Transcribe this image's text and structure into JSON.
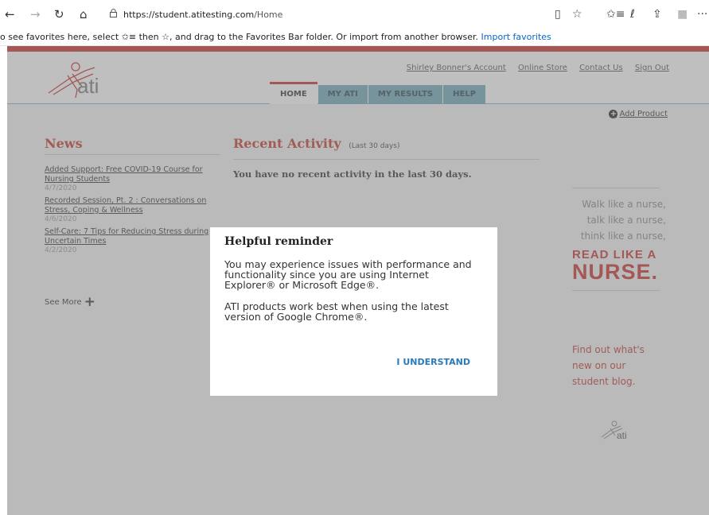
{
  "browser": {
    "back_icon": "←",
    "forward_icon": "→",
    "refresh_icon": "↻",
    "home_icon": "⌂",
    "lock_icon": "🔒",
    "url_host": "https://student.atitesting.com",
    "url_path": "/Home",
    "reading_icon": "▯",
    "favorite_icon": "☆",
    "favorites_icon": "✩≡",
    "pen_icon": "ℓ",
    "share_icon": "⇪",
    "profile_icon": "■",
    "more_icon": "···",
    "favbar_text": "o see favorites here, select ✩≡ then ☆, and drag to the Favorites Bar folder. Or import from another browser.",
    "favbar_link": "Import favorites"
  },
  "header": {
    "logo_text": "ati",
    "links": [
      "Shirley Bonner's Account",
      "Online Store",
      "Contact Us",
      "Sign Out"
    ],
    "tabs": [
      "HOME",
      "MY ATI",
      "MY RESULTS",
      "HELP"
    ],
    "active_tab": "HOME"
  },
  "add_product": "Add Product",
  "news": {
    "title": "News",
    "items": [
      {
        "title": "Added Support: Free COVID-19 Course for Nursing Students",
        "date": "4/7/2020"
      },
      {
        "title": "Recorded Session, Pt. 2 : Conversations on Stress, Coping & Wellness",
        "date": "4/6/2020"
      },
      {
        "title": "Self-Care: 7 Tips for Reducing Stress during Uncertain Times",
        "date": "4/2/2020"
      }
    ],
    "see_more": "See More"
  },
  "recent": {
    "title": "Recent Activity",
    "subtitle": "(Last 30 days)",
    "empty": "You have no recent activity in the last 30 days."
  },
  "ad": {
    "line1": "Walk like a nurse,",
    "line2": "talk like a nurse,",
    "line3": "think like a nurse,",
    "big1": "READ LIKE A",
    "big2": "NURSE.",
    "blog1": "Find out what's",
    "blog2": "new on our",
    "blog3": "student blog.",
    "logo_text": "ati"
  },
  "modal": {
    "title": "Helpful reminder",
    "para1": "You may experience issues with performance and functionality since you are using Internet Explorer® or Microsoft Edge®.",
    "para2": "ATI products work best when using the latest version of Google Chrome®.",
    "button": "I UNDERSTAND"
  },
  "colors": {
    "brand_red": "#c8302a",
    "tab_blue": "#6fa7b7",
    "link_blue": "#2a7ab9"
  }
}
